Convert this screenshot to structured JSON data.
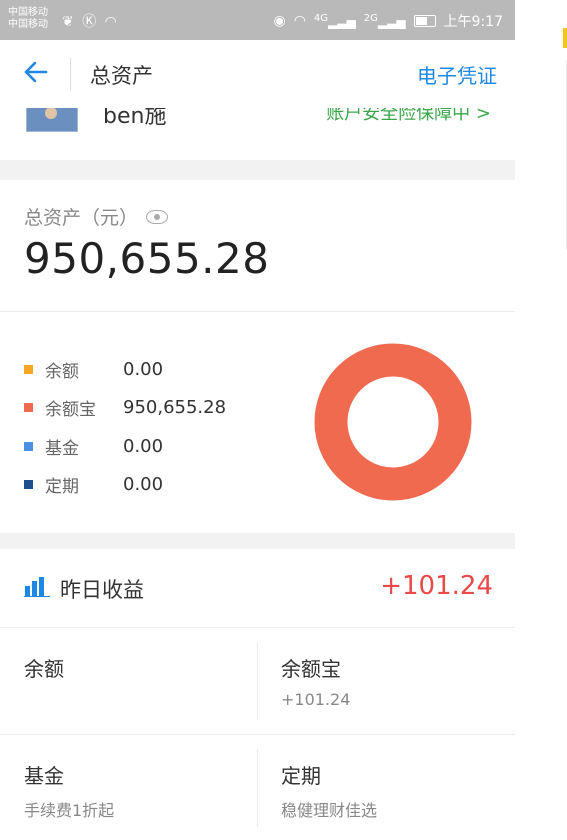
{
  "status_bar": {
    "carrier_1": "中国移动",
    "carrier_2": "中国移动",
    "network_1": "4G",
    "network_2": "2G",
    "time": "上午9:17"
  },
  "header": {
    "title": "总资产",
    "right_link": "电子凭证"
  },
  "account_peek": {
    "name": "ben施",
    "tag": "账户安全险保障中 >"
  },
  "total": {
    "label": "总资产（元）",
    "value": "950,655.28"
  },
  "legend": [
    {
      "name": "余额",
      "value": "0.00",
      "color": "#f5a623"
    },
    {
      "name": "余额宝",
      "value": "950,655.28",
      "color": "#f06a50"
    },
    {
      "name": "基金",
      "value": "0.00",
      "color": "#4a90e2"
    },
    {
      "name": "定期",
      "value": "0.00",
      "color": "#1f4e8c"
    }
  ],
  "donut": {
    "main_color": "#f06a50",
    "shares": [
      0,
      100,
      0,
      0
    ]
  },
  "yesterday": {
    "label": "昨日收益",
    "value": "+101.24",
    "icon": "bar-chart-icon",
    "icon_color": "#1e88e5",
    "value_color": "#e84a4a"
  },
  "grid": [
    {
      "name": "余额",
      "sub": ""
    },
    {
      "name": "余额宝",
      "sub": "+101.24"
    },
    {
      "name": "基金",
      "sub": "手续费1折起"
    },
    {
      "name": "定期",
      "sub": "稳健理财佳选"
    }
  ]
}
